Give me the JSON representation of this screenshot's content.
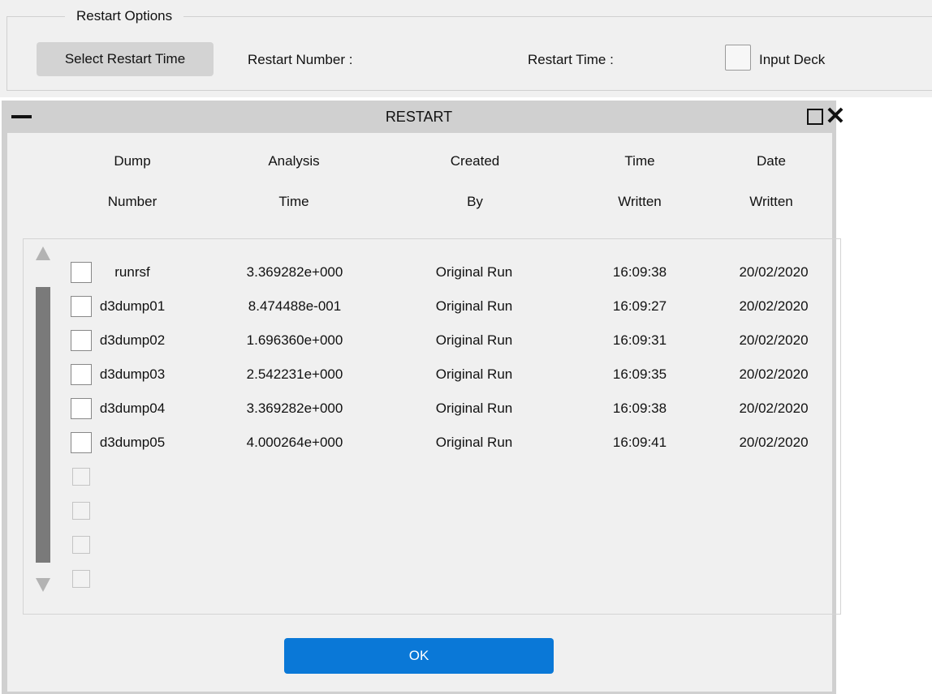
{
  "restart_options": {
    "title": "Restart Options",
    "select_button": "Select Restart Time",
    "restart_number_label": "Restart Number :",
    "restart_time_label": "Restart Time :",
    "input_deck_label": "Input Deck",
    "input_deck_checked": false
  },
  "dialog": {
    "title": "RESTART",
    "minimize_icon": "minimize-icon",
    "maximize_icon": "maximize-icon",
    "close_icon": "close-icon",
    "columns": [
      {
        "line1": "Dump",
        "line2": "Number"
      },
      {
        "line1": "Analysis",
        "line2": "Time"
      },
      {
        "line1": "Created",
        "line2": "By"
      },
      {
        "line1": "Time",
        "line2": "Written"
      },
      {
        "line1": "Date",
        "line2": "Written"
      }
    ],
    "rows": [
      {
        "dump": "runrsf",
        "analysis_time": "3.369282e+000",
        "created_by": "Original Run",
        "time_written": "16:09:38",
        "date_written": "20/02/2020"
      },
      {
        "dump": "d3dump01",
        "analysis_time": "8.474488e-001",
        "created_by": "Original Run",
        "time_written": "16:09:27",
        "date_written": "20/02/2020"
      },
      {
        "dump": "d3dump02",
        "analysis_time": "1.696360e+000",
        "created_by": "Original Run",
        "time_written": "16:09:31",
        "date_written": "20/02/2020"
      },
      {
        "dump": "d3dump03",
        "analysis_time": "2.542231e+000",
        "created_by": "Original Run",
        "time_written": "16:09:35",
        "date_written": "20/02/2020"
      },
      {
        "dump": "d3dump04",
        "analysis_time": "3.369282e+000",
        "created_by": "Original Run",
        "time_written": "16:09:38",
        "date_written": "20/02/2020"
      },
      {
        "dump": "d3dump05",
        "analysis_time": "4.000264e+000",
        "created_by": "Original Run",
        "time_written": "16:09:41",
        "date_written": "20/02/2020"
      }
    ],
    "ok_label": "OK",
    "accent_color": "#0a78d7"
  }
}
